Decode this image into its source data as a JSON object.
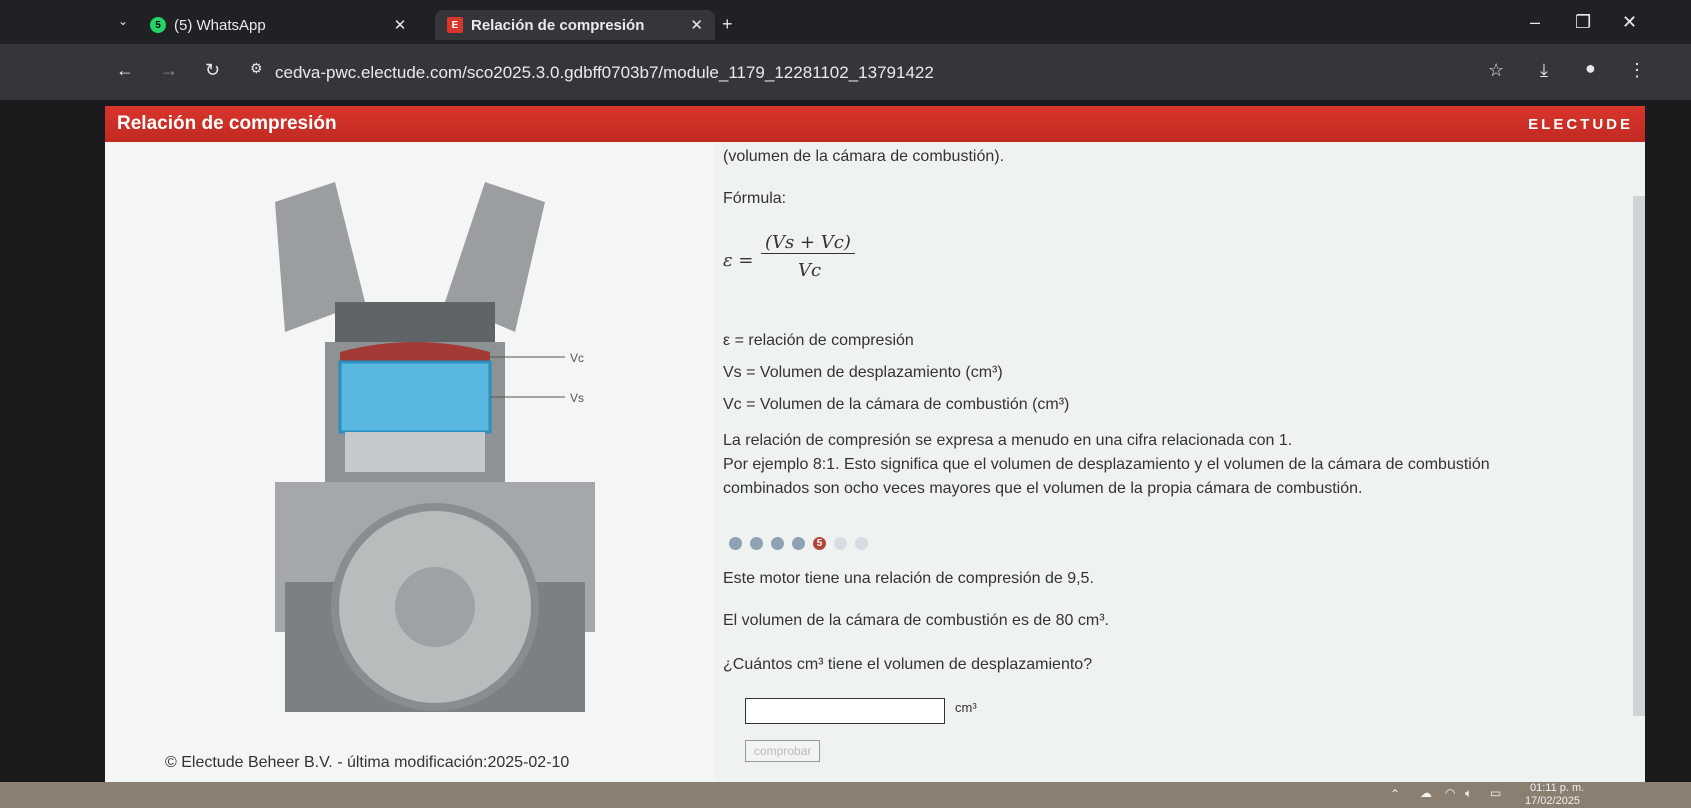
{
  "browser": {
    "tabs": [
      {
        "label": "(5) WhatsApp",
        "badge": "5",
        "icon": "whatsapp-icon"
      },
      {
        "label": "Relación de compresión",
        "icon": "electude-icon"
      }
    ],
    "url": "cedva-pwc.electude.com/sco2025.3.0.gdbff0703b7/module_1179_12281102_13791422"
  },
  "app": {
    "title": "Relación de compresión",
    "logo": "ELECTUDE",
    "accent": "#d8352c",
    "diagram_labels": {
      "vc": "Vc",
      "vs": "Vs"
    },
    "copyright": "© Electude Beheer B.V. - última modificación:2025-02-10",
    "content": {
      "intro_tail": "(volumen de la cámara de combustión).",
      "formula_label": "Fórmula:",
      "formula_lhs": "ε =",
      "formula_num": "(Vs + Vc)",
      "formula_den": "Vc",
      "def1": "ε = relación de compresión",
      "def2": "Vs = Volumen de desplazamiento (cm³)",
      "def3": "Vc = Volumen de la cámara de combustión (cm³)",
      "para1": "La relación de compresión se expresa a menudo en una cifra relacionada con 1.",
      "para2": "Por ejemplo 8:1. Esto significa que el volumen de desplazamiento y el volumen de la cámara de combustión",
      "para3": "combinados son ocho veces mayores que el volumen de la propia cámara de combustión.",
      "current_step": "5",
      "q1": "Este motor tiene una relación de compresión de 9,5.",
      "q2": "El volumen de la cámara de combustión es de 80 cm³.",
      "q3": "¿Cuántos cm³ tiene el volumen de desplazamiento?",
      "answer_value": "",
      "unit": "cm³",
      "check_button": "comprobar"
    }
  },
  "taskbar": {
    "time": "01:11 p. m.",
    "date": "17/02/2025"
  }
}
